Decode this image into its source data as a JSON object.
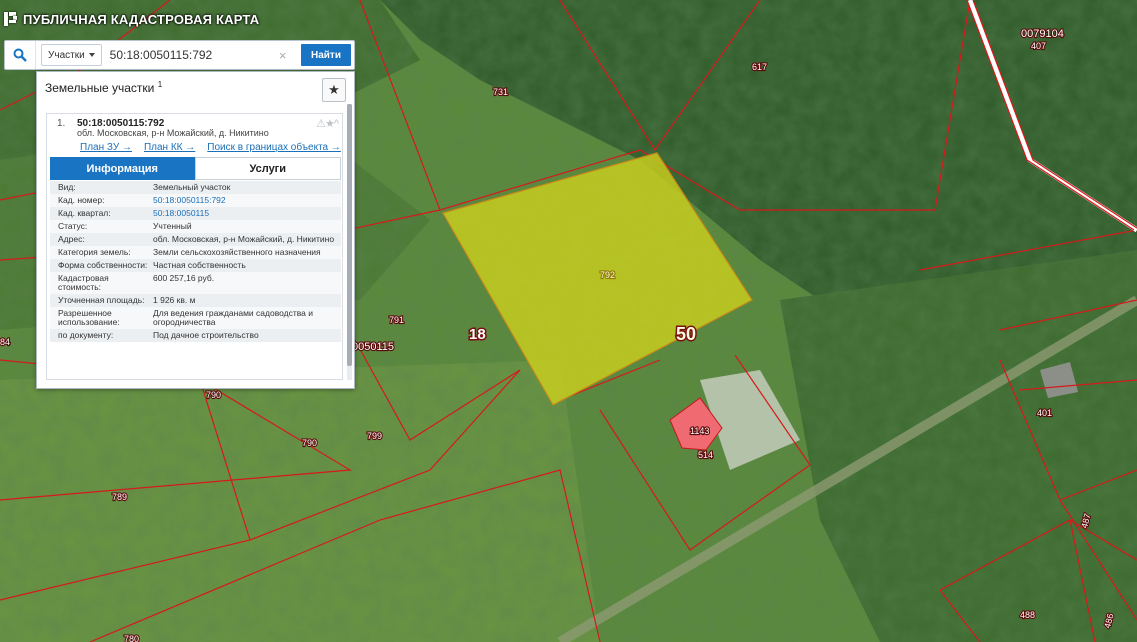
{
  "header": {
    "title": "ПУБЛИЧНАЯ КАДАСТРОВАЯ КАРТА"
  },
  "search": {
    "type_label": "Участки",
    "query": "50:18:0050115:792",
    "clear_icon": "×",
    "find_label": "Найти"
  },
  "panel": {
    "title": "Земельные участки",
    "count": "1",
    "fav_icon": "★"
  },
  "card": {
    "index": "1.",
    "cad_number": "50:18:0050115:792",
    "address": "обл. Московская, р-н Можайский, д. Никитино",
    "tools": "⚠★^",
    "links": {
      "plan_zu": "План ЗУ →",
      "plan_kk": "План КК →",
      "search_bounds": "Поиск в границах объекта →"
    },
    "tabs": {
      "info": "Информация",
      "services": "Услуги"
    },
    "properties": [
      {
        "k": "Вид:",
        "v": "Земельный участок"
      },
      {
        "k": "Кад. номер:",
        "v": "50:18:0050115:792"
      },
      {
        "k": "Кад. квартал:",
        "v": "50:18:0050115"
      },
      {
        "k": "Статус:",
        "v": "Учтенный"
      },
      {
        "k": "Адрес:",
        "v": "обл. Московская, р-н Можайский, д. Никитино"
      },
      {
        "k": "Категория земель:",
        "v": "Земли сельскохозяйственного назначения"
      },
      {
        "k": "Форма собственности:",
        "v": "Частная собственность"
      },
      {
        "k": "Кадастровая стоимость:",
        "v": "600 257,16 руб."
      },
      {
        "k": "Уточненная площадь:",
        "v": "1 926 кв. м"
      },
      {
        "k": "Разрешенное использование:",
        "v": "Для ведения гражданами садоводства и огородничества"
      },
      {
        "k": "по документу:",
        "v": "Под дачное строительство"
      }
    ]
  },
  "map": {
    "labels": {
      "l731": "731",
      "l617": "617",
      "l792": "792",
      "l50": "50",
      "l18": "18",
      "l791": "791",
      "l050115": "0050115",
      "l790a": "790",
      "l790b": "790",
      "l799": "799",
      "l789": "789",
      "l1143": "1143",
      "l514": "514",
      "l401": "401",
      "l0079104": "0079104",
      "l407": "407",
      "l487": "487",
      "l488": "488",
      "l486": "486",
      "l84": "84",
      "l780": "780"
    },
    "colors": {
      "selected_fill": "#cbcf1e",
      "boundary": "#d7191c",
      "building": "#f06a72",
      "grass": "#5d8a3a",
      "forest": "#2f5a2a"
    }
  }
}
